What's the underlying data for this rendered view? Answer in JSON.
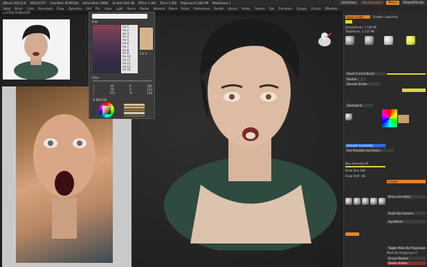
{
  "titlebar": {
    "segments": [
      "ZBrush 2022.0.8",
      "2022/07/27",
      "Free Mem 39.891GB",
      "Active Mem 10884",
      "Scratch Disk 48",
      "RTime 1.364",
      "Timer 1.200",
      "PolyCount 2.462 MP",
      "MeshCount 1"
    ],
    "buttons": {
      "quicksave": "QuickSave",
      "see_through": "See-through 0",
      "menus": "Menus",
      "default_script": "DefaultZScript"
    }
  },
  "menubar": {
    "items": [
      "Alpha",
      "Brush",
      "Color",
      "Document",
      "Draw",
      "Dynamics",
      "Edit",
      "File",
      "Layer",
      "Light",
      "Macro",
      "Marker",
      "Material",
      "Movie",
      "Picker",
      "Preferences",
      "Render",
      "Stencil",
      "Stroke",
      "Texture",
      "Tool",
      "Transform",
      "Zplugin",
      "Zscript",
      "ZModeler"
    ]
  },
  "shelf": {
    "label": "▸ LITTLE ICON LISTS"
  },
  "color_panel": {
    "title": "Ellie",
    "names": [
      "Aa-1",
      "Aa-2",
      "Aa-3",
      "Aa-4",
      "Aa-5",
      "Aa-6",
      "Aa-7",
      "Aa-8",
      "Aa-9",
      "Aa-10",
      "Aa-11",
      "Aa-12",
      "Aa-13",
      "Aa-14"
    ],
    "col_label": "Col 0",
    "filter_label": "Filter:",
    "rgb": [
      {
        "c": "R",
        "a": "40",
        "b": "185"
      },
      {
        "c": "G",
        "a": "59",
        "b": "163"
      },
      {
        "c": "B",
        "a": "165",
        "b": "118"
      }
    ],
    "hex": "# 9B3C9E"
  },
  "right_panel": {
    "header": {
      "save_config": "Save Config",
      "enable_customize": "Enable Customize"
    },
    "rows": [
      {
        "label": "ActivePoints: 1.728 Mil",
        "type": "text"
      },
      {
        "label": "TotalPoints: 2.157 Mil",
        "type": "text"
      },
      {
        "label": "Reset Current Brush",
        "type": "btn"
      },
      {
        "label": "Double",
        "type": "btn"
      },
      {
        "label": "Smooth Stroke",
        "type": "btn"
      },
      {
        "label": "Topological",
        "type": "btn"
      },
      {
        "label": "Activate Symmetry",
        "type": "btn",
        "style": "b"
      },
      {
        "label": "Use Poseable Symmetry",
        "type": "btn"
      },
      {
        "label": "Max Intensity 60",
        "type": "text"
      },
      {
        "label": "Draw Size 140",
        "type": "text"
      },
      {
        "label": "Focal Shift -48",
        "type": "text"
      },
      {
        "label": "Crease",
        "type": "btn",
        "style": "o"
      },
      {
        "label": "Mirror And Weld",
        "type": "btn"
      },
      {
        "label": "Polish By Features",
        "type": "btn"
      },
      {
        "label": "DynaMesh",
        "type": "btn"
      },
      {
        "label": "Toggle Mask By Polygroups",
        "type": "btn"
      },
      {
        "label": "Mask By Polygroups 0",
        "type": "text"
      },
      {
        "label": "Group Masked",
        "type": "btn"
      },
      {
        "label": "Delete Hidden",
        "type": "btn"
      }
    ],
    "colors": {
      "accent": "#d9d93a",
      "blue": "#2d6bd6",
      "orange": "#e7832a"
    }
  },
  "reference_top": {
    "caption": ""
  },
  "reference_left": {
    "caption": ""
  }
}
